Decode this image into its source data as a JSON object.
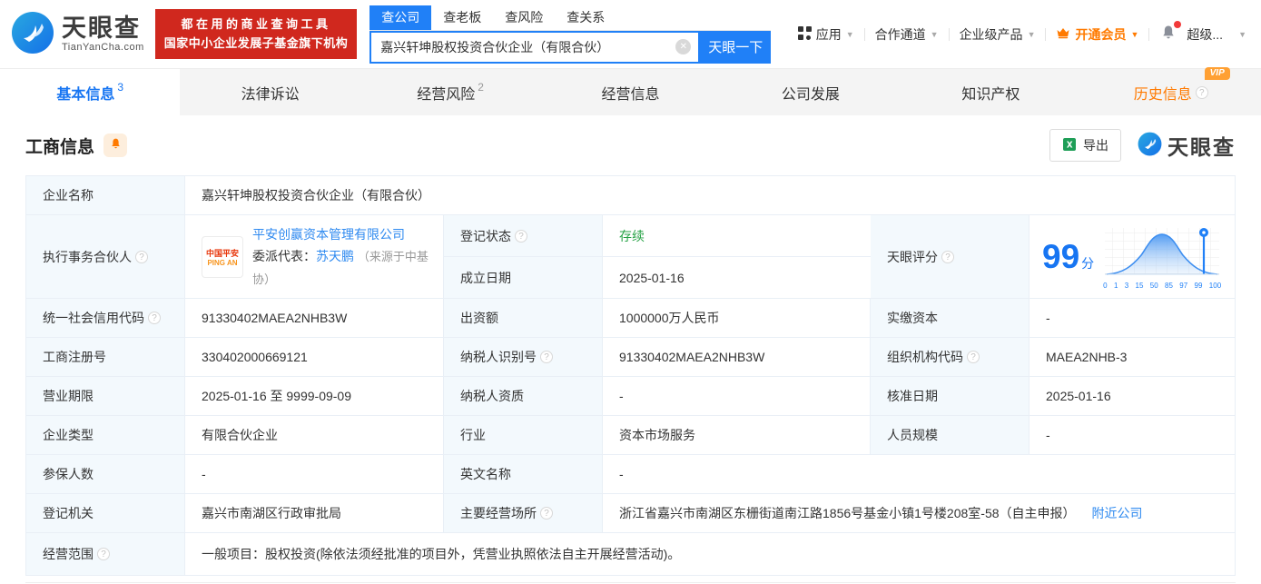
{
  "colors": {
    "accent": "#2080f7",
    "green": "#26a245",
    "orange": "#ff7a00",
    "red": "#d0281e"
  },
  "topbar": {
    "brand": "天眼查",
    "brand_domain": "TianYanCha.com",
    "promo_line1": "都在用的商业查询工具",
    "promo_line2": "国家中小企业发展子基金旗下机构",
    "search_tabs": [
      {
        "label": "查公司"
      },
      {
        "label": "查老板"
      },
      {
        "label": "查风险"
      },
      {
        "label": "查关系"
      }
    ],
    "search_value": "嘉兴轩坤股权投资合伙企业（有限合伙）",
    "search_button": "天眼一下",
    "nav_app": "应用",
    "nav_partner": "合作通道",
    "nav_enterprise": "企业级产品",
    "nav_vip": "开通会员",
    "nav_super": "超级..."
  },
  "page_tabs": [
    {
      "label": "基本信息",
      "badge": "3"
    },
    {
      "label": "法律诉讼",
      "badge": ""
    },
    {
      "label": "经营风险",
      "badge": "2"
    },
    {
      "label": "经营信息",
      "badge": ""
    },
    {
      "label": "公司发展",
      "badge": ""
    },
    {
      "label": "知识产权",
      "badge": ""
    },
    {
      "label": "历史信息",
      "badge": "",
      "vip_badge": "VIP"
    }
  ],
  "section": {
    "title": "工商信息",
    "export_label": "导出",
    "brand_watermark": "天眼查"
  },
  "partner": {
    "logo_line1": "中国平安",
    "logo_line2": "PING AN",
    "company": "平安创赢资本管理有限公司",
    "delegate_label": "委派代表：",
    "delegate_name": "苏天鹏",
    "delegate_source": "（来源于中基协）"
  },
  "score_chart": {
    "type": "area",
    "value": "99",
    "unit": "分",
    "axis_labels": [
      "0",
      "1",
      "3",
      "15",
      "50",
      "85",
      "97",
      "99",
      "100"
    ],
    "marker_at": "99"
  },
  "fields": {
    "company_name": {
      "label": "企业名称",
      "value": "嘉兴轩坤股权投资合伙企业（有限合伙）"
    },
    "managing_partner": {
      "label": "执行事务合伙人"
    },
    "reg_status": {
      "label": "登记状态",
      "value": "存续"
    },
    "est_date": {
      "label": "成立日期",
      "value": "2025-01-16"
    },
    "score": {
      "label": "天眼评分"
    },
    "credit_code": {
      "label": "统一社会信用代码",
      "value": "91330402MAEA2NHB3W"
    },
    "capital": {
      "label": "出资额",
      "value": "1000000万人民币"
    },
    "paid_capital": {
      "label": "实缴资本",
      "value": "-"
    },
    "reg_number": {
      "label": "工商注册号",
      "value": "330402000669121"
    },
    "taxpayer_id": {
      "label": "纳税人识别号",
      "value": "91330402MAEA2NHB3W"
    },
    "org_code": {
      "label": "组织机构代码",
      "value": "MAEA2NHB-3"
    },
    "business_term": {
      "label": "营业期限",
      "value": "2025-01-16 至 9999-09-09"
    },
    "taxpayer_quality": {
      "label": "纳税人资质",
      "value": "-"
    },
    "approval_date": {
      "label": "核准日期",
      "value": "2025-01-16"
    },
    "company_type": {
      "label": "企业类型",
      "value": "有限合伙企业"
    },
    "industry": {
      "label": "行业",
      "value": "资本市场服务"
    },
    "staff_size": {
      "label": "人员规模",
      "value": "-"
    },
    "insured_count": {
      "label": "参保人数",
      "value": "-"
    },
    "english_name": {
      "label": "英文名称",
      "value": "-"
    },
    "reg_authority": {
      "label": "登记机关",
      "value": "嘉兴市南湖区行政审批局"
    },
    "business_address": {
      "label": "主要经营场所",
      "value": "浙江省嘉兴市南湖区东栅街道南江路1856号基金小镇1号楼208室-58（自主申报）",
      "link": "附近公司"
    },
    "business_scope": {
      "label": "经营范围",
      "value": "一般项目：股权投资(除依法须经批准的项目外，凭营业执照依法自主开展经营活动)。"
    }
  }
}
